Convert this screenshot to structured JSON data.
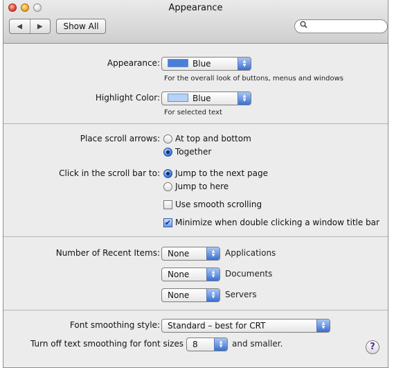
{
  "window": {
    "title": "Appearance"
  },
  "toolbar": {
    "back_glyph": "◀",
    "forward_glyph": "▶",
    "show_all_label": "Show All",
    "search_placeholder": "",
    "search_icon": "magnifier-icon"
  },
  "appearance": {
    "label": "Appearance:",
    "value": "Blue",
    "swatch_color": "#4a7fd8",
    "hint": "For the overall look of buttons, menus and windows"
  },
  "highlight": {
    "label": "Highlight Color:",
    "value": "Blue",
    "swatch_color": "#b7d2f7",
    "hint": "For selected text"
  },
  "scroll_arrows": {
    "label": "Place scroll arrows:",
    "options": [
      "At top and bottom",
      "Together"
    ],
    "selected": 1
  },
  "click_scroll": {
    "label": "Click in the scroll bar to:",
    "options": [
      "Jump to the next page",
      "Jump to here"
    ],
    "selected": 0
  },
  "checkboxes": [
    {
      "label": "Use smooth scrolling",
      "checked": false
    },
    {
      "label": "Minimize when double clicking a window title bar",
      "checked": true
    }
  ],
  "recent": {
    "label": "Number of Recent Items:",
    "rows": [
      {
        "value": "None",
        "label": "Applications"
      },
      {
        "value": "None",
        "label": "Documents"
      },
      {
        "value": "None",
        "label": "Servers"
      }
    ]
  },
  "font_smoothing": {
    "label": "Font smoothing style:",
    "value": "Standard – best for CRT",
    "turn_off_label": "Turn off text smoothing for font sizes",
    "size_value": "8",
    "suffix": "and smaller."
  },
  "help": {
    "glyph": "?"
  }
}
